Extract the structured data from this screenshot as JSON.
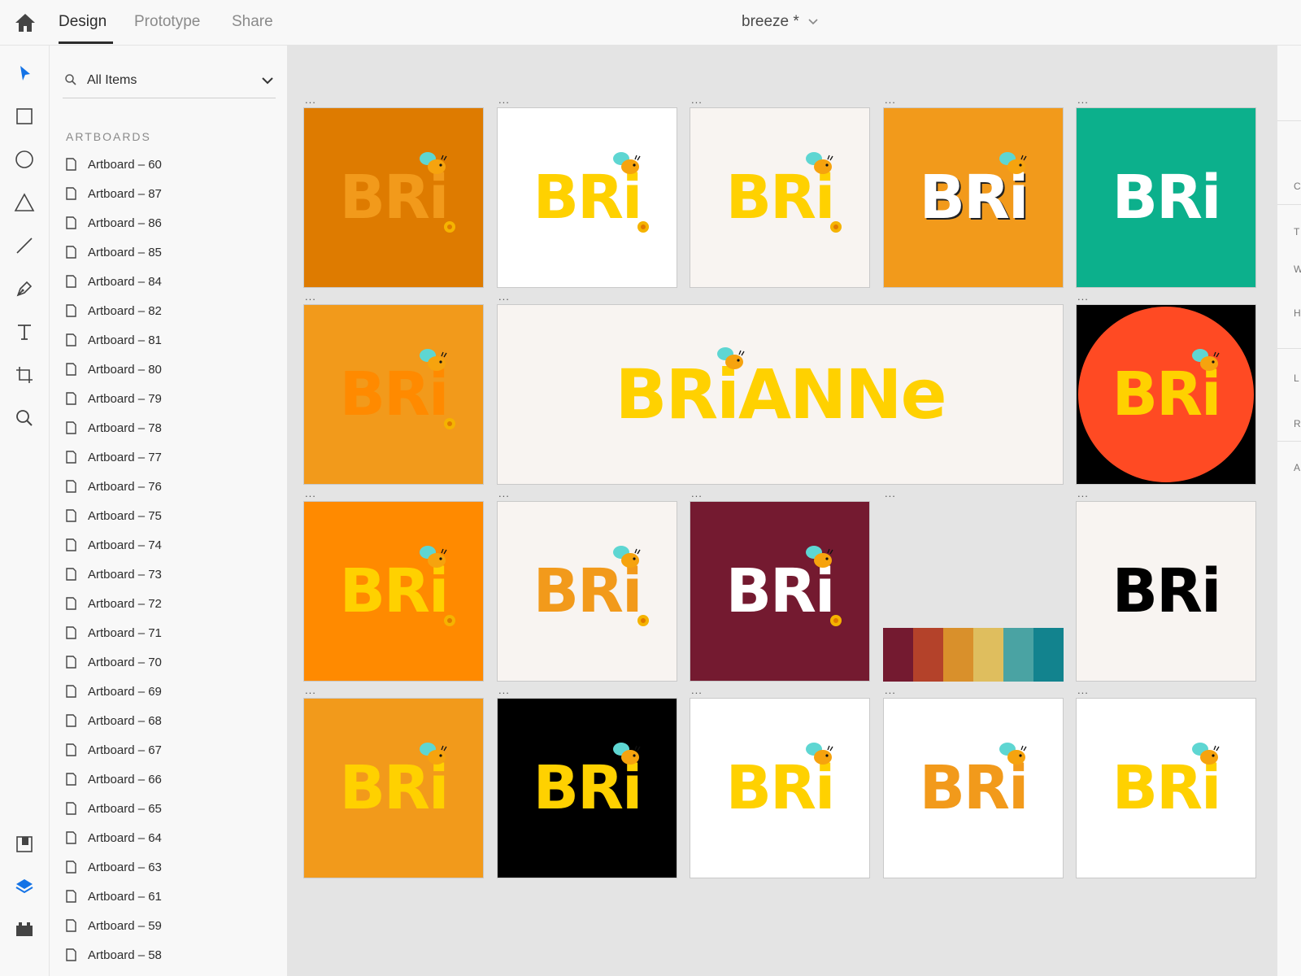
{
  "app": {
    "tabs": [
      {
        "label": "Design"
      },
      {
        "label": "Prototype"
      },
      {
        "label": "Share"
      }
    ],
    "doc_title": "breeze *"
  },
  "tools": [
    "select-tool",
    "rectangle-tool",
    "ellipse-tool",
    "triangle-tool",
    "line-tool",
    "pen-tool",
    "text-tool",
    "artboard-tool",
    "zoom-tool",
    "assets-tool",
    "layers-tool",
    "plugins-tool"
  ],
  "layers_panel": {
    "search_value": "All Items",
    "section_title": "ARTBOARDS",
    "artboards": [
      "Artboard – 60",
      "Artboard – 87",
      "Artboard – 86",
      "Artboard – 85",
      "Artboard – 84",
      "Artboard – 82",
      "Artboard – 81",
      "Artboard – 80",
      "Artboard – 79",
      "Artboard – 78",
      "Artboard – 77",
      "Artboard – 76",
      "Artboard – 75",
      "Artboard – 74",
      "Artboard – 73",
      "Artboard – 72",
      "Artboard – 71",
      "Artboard – 70",
      "Artboard – 69",
      "Artboard – 68",
      "Artboard – 67",
      "Artboard – 66",
      "Artboard – 65",
      "Artboard – 64",
      "Artboard – 63",
      "Artboard – 61",
      "Artboard – 59",
      "Artboard – 58"
    ]
  },
  "canvas": {
    "dots": "...",
    "logo_short": "BRi",
    "logo_long": "BRiANNe",
    "palette": [
      "#741a30",
      "#b4422a",
      "#d9902b",
      "#dfbe5e",
      "#4aa3a3",
      "#12838e"
    ],
    "colors": {
      "orange_dark": "#de7b00",
      "orange": "#f29a1b",
      "orange_bright": "#ff8a00",
      "yellow": "#ffd100",
      "white": "#ffffff",
      "cream": "#f8f4f1",
      "teal": "#0cb08c",
      "red": "#ff4a23",
      "maroon": "#741a30",
      "black": "#000000"
    }
  },
  "right_panel": {
    "labels": [
      "C",
      "T",
      "W",
      "H",
      "L",
      "R",
      "A"
    ]
  }
}
